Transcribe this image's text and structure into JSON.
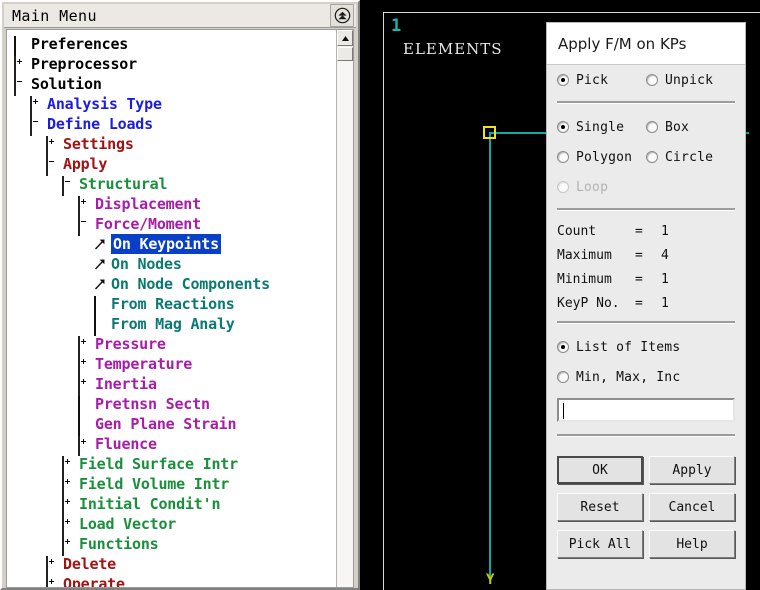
{
  "main_menu": {
    "title": "Main Menu",
    "collapse_icon": "double-chevron-up-icon",
    "tree": [
      {
        "label": "Preferences",
        "indent": 0,
        "icon": "dialog",
        "color": "#000000"
      },
      {
        "label": "Preprocessor",
        "indent": 0,
        "icon": "plus",
        "color": "#000000"
      },
      {
        "label": "Solution",
        "indent": 0,
        "icon": "minus",
        "color": "#000000"
      },
      {
        "label": "Analysis Type",
        "indent": 1,
        "icon": "plus",
        "color": "#1c1ce0"
      },
      {
        "label": "Define Loads",
        "indent": 1,
        "icon": "minus",
        "color": "#1c1ce0"
      },
      {
        "label": "Settings",
        "indent": 2,
        "icon": "plus",
        "color": "#a01414"
      },
      {
        "label": "Apply",
        "indent": 2,
        "icon": "minus",
        "color": "#a01414"
      },
      {
        "label": "Structural",
        "indent": 3,
        "icon": "minus",
        "color": "#1a8f3c"
      },
      {
        "label": "Displacement",
        "indent": 4,
        "icon": "plus",
        "color": "#a81ca8"
      },
      {
        "label": "Force/Moment",
        "indent": 4,
        "icon": "minus",
        "color": "#a81ca8"
      },
      {
        "label": "On Keypoints",
        "indent": 5,
        "icon": "arrow",
        "color": "#0b7a72",
        "selected": true
      },
      {
        "label": "On Nodes",
        "indent": 5,
        "icon": "arrow",
        "color": "#0b7a72"
      },
      {
        "label": "On Node Components",
        "indent": 5,
        "icon": "arrow",
        "color": "#0b7a72"
      },
      {
        "label": "From Reactions",
        "indent": 5,
        "icon": "dialog",
        "color": "#0b7a72"
      },
      {
        "label": "From Mag Analy",
        "indent": 5,
        "icon": "dialog",
        "color": "#0b7a72"
      },
      {
        "label": "Pressure",
        "indent": 4,
        "icon": "plus",
        "color": "#a81ca8"
      },
      {
        "label": "Temperature",
        "indent": 4,
        "icon": "plus",
        "color": "#a81ca8"
      },
      {
        "label": "Inertia",
        "indent": 4,
        "icon": "plus",
        "color": "#a81ca8"
      },
      {
        "label": "Pretnsn Sectn",
        "indent": 4,
        "icon": "dialog",
        "color": "#a81ca8"
      },
      {
        "label": "Gen Plane Strain",
        "indent": 4,
        "icon": "dialog",
        "color": "#a81ca8"
      },
      {
        "label": "Fluence",
        "indent": 4,
        "icon": "plus",
        "color": "#a81ca8"
      },
      {
        "label": "Field Surface Intr",
        "indent": 3,
        "icon": "plus",
        "color": "#1a8f3c"
      },
      {
        "label": "Field Volume Intr",
        "indent": 3,
        "icon": "plus",
        "color": "#1a8f3c"
      },
      {
        "label": "Initial Condit'n",
        "indent": 3,
        "icon": "plus",
        "color": "#1a8f3c"
      },
      {
        "label": "Load Vector",
        "indent": 3,
        "icon": "plus",
        "color": "#1a8f3c"
      },
      {
        "label": "Functions",
        "indent": 3,
        "icon": "plus",
        "color": "#1a8f3c"
      },
      {
        "label": "Delete",
        "indent": 2,
        "icon": "plus",
        "color": "#a01414"
      },
      {
        "label": "Operate",
        "indent": 2,
        "icon": "plus",
        "color": "#a01414"
      }
    ],
    "scrollbar": {
      "up_icon": "triangle-up-icon"
    }
  },
  "graphics": {
    "window_number": "1",
    "caption": "ELEMENTS",
    "axis_label_y": "Y",
    "keypoint_marker": "picked-keypoint-marker",
    "line_color": "#11a9a2",
    "marker_color": "#f2e21a"
  },
  "picker": {
    "title": "Apply F/M on KPs",
    "mode": [
      {
        "label": "Pick",
        "selected": true
      },
      {
        "label": "Unpick",
        "selected": false
      }
    ],
    "shape": [
      {
        "label": "Single",
        "selected": true,
        "disabled": false
      },
      {
        "label": "Box",
        "selected": false,
        "disabled": false
      },
      {
        "label": "Polygon",
        "selected": false,
        "disabled": false
      },
      {
        "label": "Circle",
        "selected": false,
        "disabled": false
      },
      {
        "label": "Loop",
        "selected": false,
        "disabled": true
      }
    ],
    "counters": [
      {
        "name": "Count",
        "eq": "=",
        "value": "1"
      },
      {
        "name": "Maximum",
        "eq": "=",
        "value": "4"
      },
      {
        "name": "Minimum",
        "eq": "=",
        "value": "1"
      },
      {
        "name": "KeyP No.",
        "eq": "=",
        "value": "1"
      }
    ],
    "entry_mode": [
      {
        "label": "List of Items",
        "selected": true
      },
      {
        "label": "Min, Max, Inc",
        "selected": false
      }
    ],
    "input": {
      "value": "",
      "placeholder": ""
    },
    "buttons": [
      {
        "label": "OK",
        "default": true
      },
      {
        "label": "Apply",
        "default": false
      },
      {
        "label": "Reset",
        "default": false
      },
      {
        "label": "Cancel",
        "default": false
      },
      {
        "label": "Pick All",
        "default": false
      },
      {
        "label": "Help",
        "default": false
      }
    ]
  }
}
